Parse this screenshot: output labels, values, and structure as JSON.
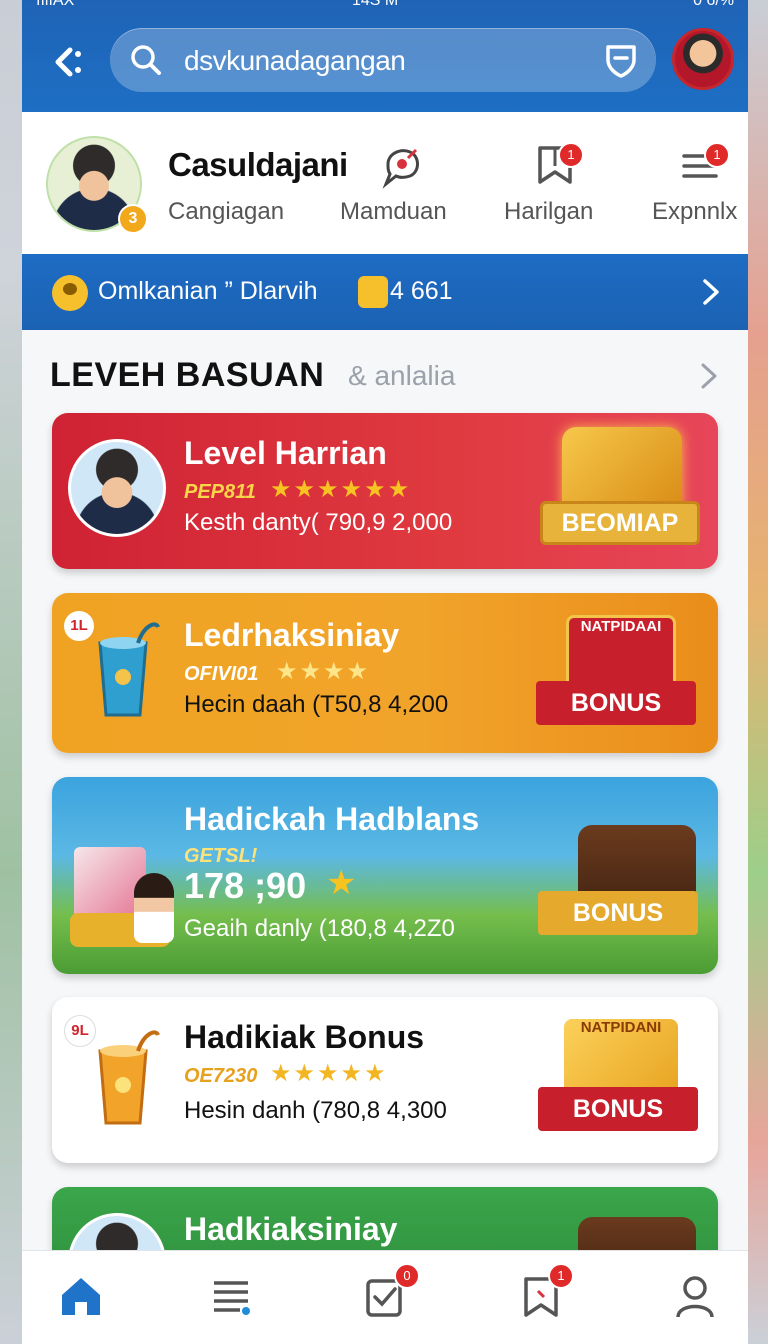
{
  "status_bar": {
    "left": "ıılıAX",
    "time": "14S M",
    "battery": "0 6/%"
  },
  "search": {
    "query": "dsvkunadagangan"
  },
  "profile": {
    "name": "Casuldajani",
    "level_badge": "3",
    "tabs": [
      {
        "label": "Cangiagan"
      },
      {
        "label": "Mamduan"
      },
      {
        "label": "Harilgan",
        "badge": "1"
      },
      {
        "label": "Expnnlx",
        "badge": "1"
      }
    ]
  },
  "info_strip": {
    "text": "Omlkanian ” Dlarvih",
    "coins": "4 661"
  },
  "section": {
    "title": "LEVEH BASUAN",
    "subtitle": "& anlalia"
  },
  "cards": [
    {
      "title": "Level Harrian",
      "code": "PEP811",
      "stars": "★★★★★★",
      "desc": "Kesth danty( 790,9 2,000",
      "badge_text": "BEOMIAP",
      "accent": "#cf2234"
    },
    {
      "rank": "1L",
      "title": "Ledrhaksiniay",
      "code": "OFIVI01",
      "stars": "★★★★",
      "desc": "Hecin daah (T50,8 4,200",
      "ticket": "NATPIDAAI",
      "badge_text": "BONUS",
      "accent": "#f0a322"
    },
    {
      "title": "Hadickah Hadblans",
      "code": "GETSL!",
      "score": "178 ;90",
      "desc": "Geaih danly (180,8 4,2Z0",
      "badge_text": "BONUS",
      "accent": "#4a9c34"
    },
    {
      "rank": "9L",
      "title": "Hadikiak Bonus",
      "code": "OE7230",
      "stars": "★★★★★",
      "desc": "Hesin danh (780,8 4,300",
      "ticket": "NATPIDANI",
      "badge_text": "BONUS",
      "accent": "#ffffff"
    },
    {
      "title": "Hadkiaksiniay",
      "accent": "#3aa64a"
    }
  ],
  "nav": [
    {
      "icon": "home-icon"
    },
    {
      "icon": "list-icon"
    },
    {
      "icon": "task-icon",
      "badge": "0"
    },
    {
      "icon": "bookmark-icon",
      "badge": "1"
    },
    {
      "icon": "profile-icon"
    }
  ]
}
